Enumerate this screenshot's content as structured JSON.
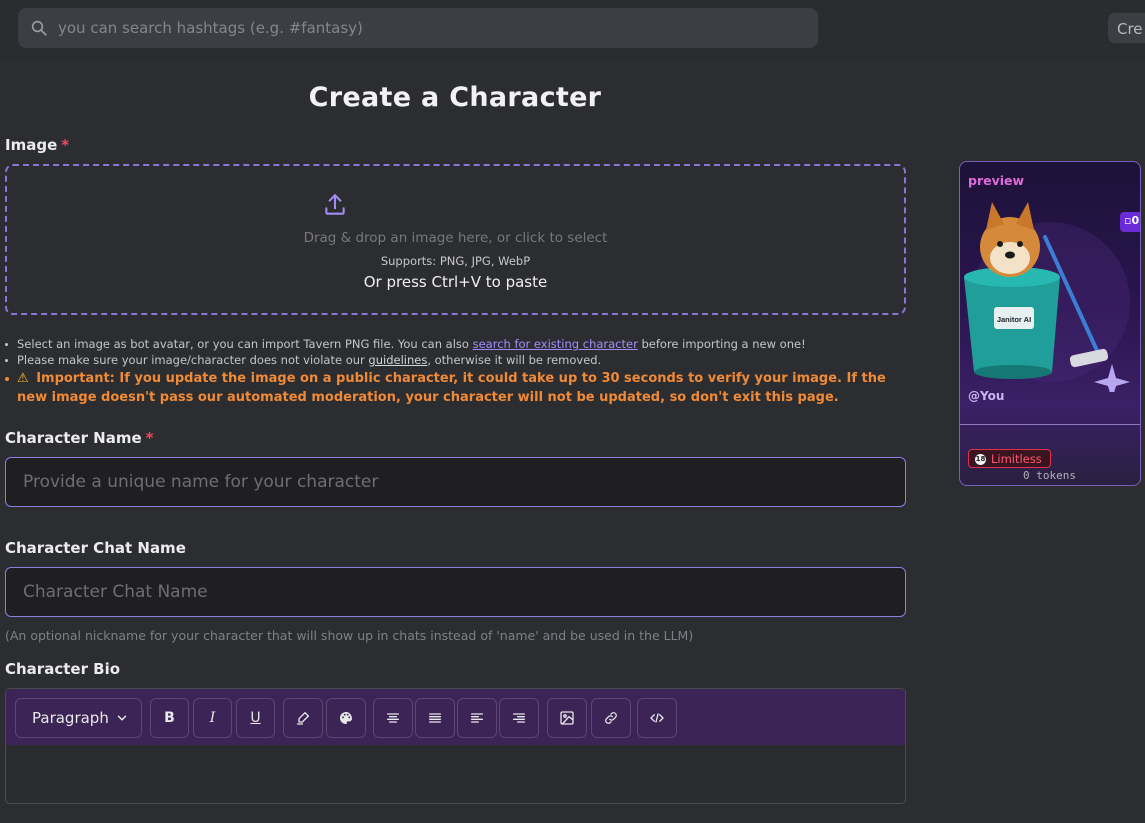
{
  "header": {
    "search_placeholder": "you can search hashtags (e.g. #fantasy)",
    "create_label": "Cre"
  },
  "page": {
    "title": "Create a Character"
  },
  "image_section": {
    "label": "Image",
    "required_mark": "*",
    "dropzone_text": "Drag & drop an image here, or click to select",
    "supports_text": "Supports: PNG, JPG, WebP",
    "paste_text": "Or press Ctrl+V to paste"
  },
  "notes": {
    "n1_before": "Select an image as bot avatar, or you can import Tavern PNG file. You can also ",
    "n1_link": "search for existing character",
    "n1_after": " before importing a new one!",
    "n2_before": "Please make sure your image/character does not violate our ",
    "n2_link": "guidelines",
    "n2_after": ", otherwise it will be removed.",
    "warning_icon": "⚠",
    "important_label": "Important:",
    "important_text": "If you update the image on a public character, it could take up to 30 seconds to verify your image. If the new image doesn't pass our automated moderation, your character will not be updated, so don't exit this page."
  },
  "name_field": {
    "label": "Character Name",
    "required_mark": "*",
    "placeholder": "Provide a unique name for your character"
  },
  "chat_name_field": {
    "label": "Character Chat Name",
    "placeholder": "Character Chat Name",
    "hint": "(An optional nickname for your character that will show up in chats instead of 'name' and be used in the LLM)"
  },
  "bio": {
    "label": "Character Bio",
    "toolbar": {
      "paragraph": "Paragraph",
      "bold": "B",
      "italic": "I",
      "underline": "U"
    }
  },
  "preview": {
    "label": "preview",
    "badge": "0",
    "bucket_text": "Janitor AI",
    "user": "@You",
    "tag_icon": "18",
    "tag": "Limitless",
    "tokens": "0 tokens"
  }
}
